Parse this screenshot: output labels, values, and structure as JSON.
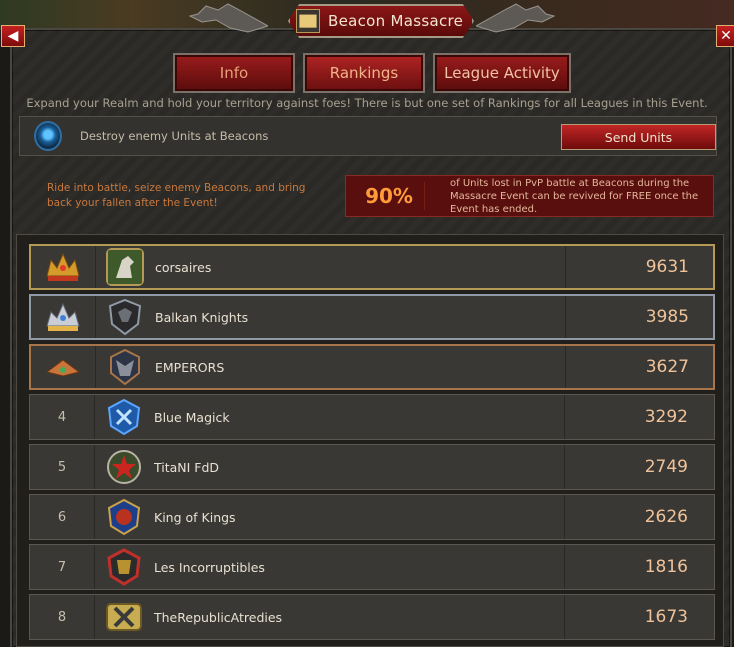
{
  "window": {
    "title": "Beacon Massacre",
    "back_icon": "back-arrow-icon",
    "close_icon": "close-icon"
  },
  "tabs": [
    {
      "label": "Info",
      "active": false
    },
    {
      "label": "Rankings",
      "active": true
    },
    {
      "label": "League Activity",
      "active": false
    }
  ],
  "intro_text": "Expand your Realm and hold your territory against foes! There is but one set of Rankings for all Leagues in this Event.",
  "objective": {
    "text": "Destroy enemy Units at Beacons",
    "button_label": "Send Units"
  },
  "ride_text": "Ride into battle, seize enemy Beacons, and bring back your fallen after the Event!",
  "revive": {
    "percent": "90%",
    "text": "of Units lost in PvP battle at Beacons during the Massacre Event can be revived for FREE once the Event has ended."
  },
  "colors": {
    "gold": "#b59a56",
    "silver": "#8f9aa6",
    "bronze": "#a8744a",
    "accent_red": "#8c1717",
    "score": "#f0c39a"
  },
  "rankings": [
    {
      "rank": "",
      "rank_icon": "gold-crown-icon",
      "name": "corsaires",
      "score": "9631",
      "emblem": "dragon-emblem"
    },
    {
      "rank": "",
      "rank_icon": "silver-crown-icon",
      "name": "Balkan Knights",
      "score": "3985",
      "emblem": "black-eagle-emblem"
    },
    {
      "rank": "",
      "rank_icon": "bronze-crown-icon",
      "name": "EMPERORS",
      "score": "3627",
      "emblem": "bull-emblem"
    },
    {
      "rank": "4",
      "name": "Blue Magick",
      "score": "3292",
      "emblem": "blue-rune-emblem"
    },
    {
      "rank": "5",
      "name": "TitaNI FdD",
      "score": "2749",
      "emblem": "red-star-emblem"
    },
    {
      "rank": "6",
      "name": "King of Kings",
      "score": "2626",
      "emblem": "helmet-emblem"
    },
    {
      "rank": "7",
      "name": "Les Incorruptibles",
      "score": "1816",
      "emblem": "knight-emblem"
    },
    {
      "rank": "8",
      "name": "TheRepublicAtredies",
      "score": "1673",
      "emblem": "crossed-swords-emblem"
    }
  ]
}
